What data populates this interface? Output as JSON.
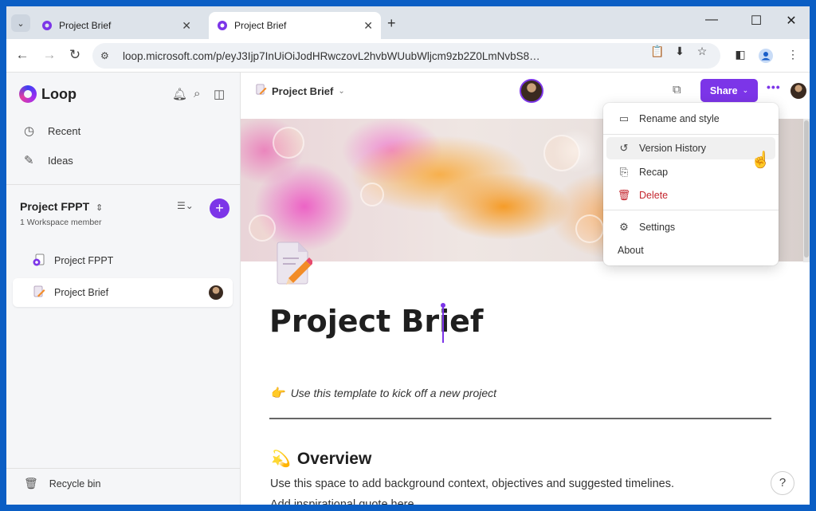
{
  "browser": {
    "tabs": [
      {
        "label": "Project Brief",
        "close": "✕"
      },
      {
        "label": "Project Brief",
        "close": "✕"
      }
    ],
    "new_tab": "+",
    "url": "loop.microsoft.com/p/eyJ3Ijp7InUiOiJodHRwczovL2hvbWUubWljcm9zb2Z0LmNvbS8…"
  },
  "sidebar": {
    "app_name": "Loop",
    "nav": [
      {
        "label": "Recent",
        "icon": "clock-icon"
      },
      {
        "label": "Ideas",
        "icon": "pen-icon"
      }
    ],
    "workspace": {
      "title": "Project FPPT",
      "subtitle": "1 Workspace member",
      "add": "+"
    },
    "pages": [
      {
        "label": "Project FPPT"
      },
      {
        "label": "Project Brief"
      }
    ],
    "recycle_bin": "Recycle bin"
  },
  "header": {
    "breadcrumb": "Project Brief",
    "share_label": "Share",
    "more": "•••"
  },
  "document": {
    "title": "Project Brief",
    "intro": "Use this template to kick off a new project",
    "overview_heading": "Overview",
    "overview_text": "Use this space to add background context, objectives and suggested timelines.",
    "quote_text": "Add inspirational quote here."
  },
  "menu": {
    "items": [
      {
        "label": "Rename and style",
        "icon": "rename-icon"
      },
      {
        "label": "Version History",
        "icon": "history-icon"
      },
      {
        "label": "Recap",
        "icon": "recap-icon"
      },
      {
        "label": "Delete",
        "icon": "trash-icon"
      },
      {
        "label": "Settings",
        "icon": "gear-icon"
      },
      {
        "label": "About",
        "icon": ""
      }
    ]
  },
  "help": "?",
  "colors": {
    "accent": "#7c35e8",
    "danger": "#c4262e",
    "frame": "#0b5ec4"
  }
}
